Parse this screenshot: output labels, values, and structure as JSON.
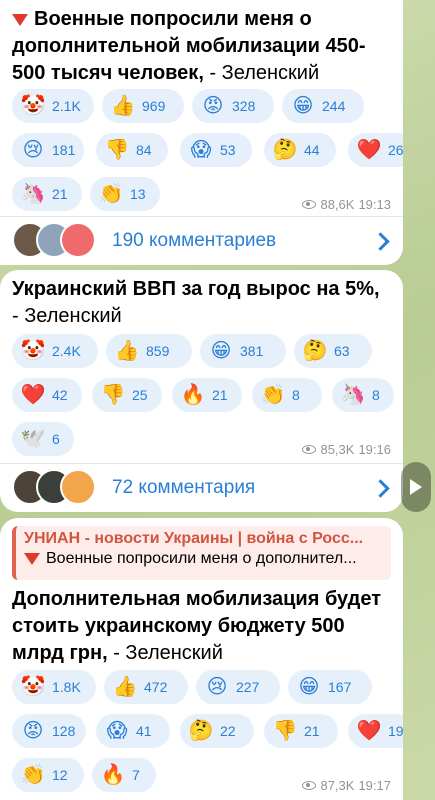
{
  "messages": [
    {
      "headline": "Военные попросили меня о дополнительной мобилизации 450-500 тысяч человек,",
      "author": " - Зеленский",
      "reactions": [
        {
          "emoji": "🤡",
          "count": "2.1K"
        },
        {
          "emoji": "👍",
          "count": "969"
        },
        {
          "emoji": "😡",
          "count": "328"
        },
        {
          "emoji": "😁",
          "count": "244"
        },
        {
          "emoji": "😢",
          "count": "181"
        },
        {
          "emoji": "👎",
          "count": "84"
        },
        {
          "emoji": "😱",
          "count": "53"
        },
        {
          "emoji": "🤔",
          "count": "44"
        },
        {
          "emoji": "❤️",
          "count": "26"
        },
        {
          "emoji": "🦄",
          "count": "21"
        },
        {
          "emoji": "👏",
          "count": "13"
        }
      ],
      "views": "88,6K",
      "time": "19:13",
      "comments": "190 комментариев"
    },
    {
      "headline": "Украинский ВВП за год вырос на 5%,",
      "author": " - Зеленский",
      "reactions": [
        {
          "emoji": "🤡",
          "count": "2.4K"
        },
        {
          "emoji": "👍",
          "count": "859"
        },
        {
          "emoji": "😁",
          "count": "381"
        },
        {
          "emoji": "🤔",
          "count": "63"
        },
        {
          "emoji": "❤️",
          "count": "42"
        },
        {
          "emoji": "👎",
          "count": "25"
        },
        {
          "emoji": "🔥",
          "count": "21"
        },
        {
          "emoji": "👏",
          "count": "8"
        },
        {
          "emoji": "🦄",
          "count": "8"
        },
        {
          "emoji": "🕊️",
          "count": "6"
        }
      ],
      "views": "85,3K",
      "time": "19:16",
      "comments": "72 комментария"
    },
    {
      "forward_channel": "УНИАН - новости Украины | война с Росс...",
      "forward_quote": "Военные попросили меня о дополнител...",
      "headline": "Дополнительная мобилизация будет стоить украинскому бюджету 500 млрд грн,",
      "author": " - Зеленский",
      "reactions": [
        {
          "emoji": "🤡",
          "count": "1.8K"
        },
        {
          "emoji": "👍",
          "count": "472"
        },
        {
          "emoji": "😢",
          "count": "227"
        },
        {
          "emoji": "😁",
          "count": "167"
        },
        {
          "emoji": "😡",
          "count": "128"
        },
        {
          "emoji": "😱",
          "count": "41"
        },
        {
          "emoji": "🤔",
          "count": "22"
        },
        {
          "emoji": "👎",
          "count": "21"
        },
        {
          "emoji": "❤️",
          "count": "19"
        },
        {
          "emoji": "👏",
          "count": "12"
        },
        {
          "emoji": "🔥",
          "count": "7"
        }
      ],
      "views": "87,3K",
      "time": "19:17"
    }
  ],
  "colors": {
    "accent": "#2a7fd4",
    "pill_bg": "#e6f0fb",
    "meta": "#8e959b",
    "forward_accent": "#e0614f",
    "alert_red": "#e0392b"
  },
  "icons": {
    "alert": "red-down-triangle-icon",
    "views": "eye-icon",
    "chevron": "chevron-right-icon",
    "share": "forward-arrow-icon"
  }
}
